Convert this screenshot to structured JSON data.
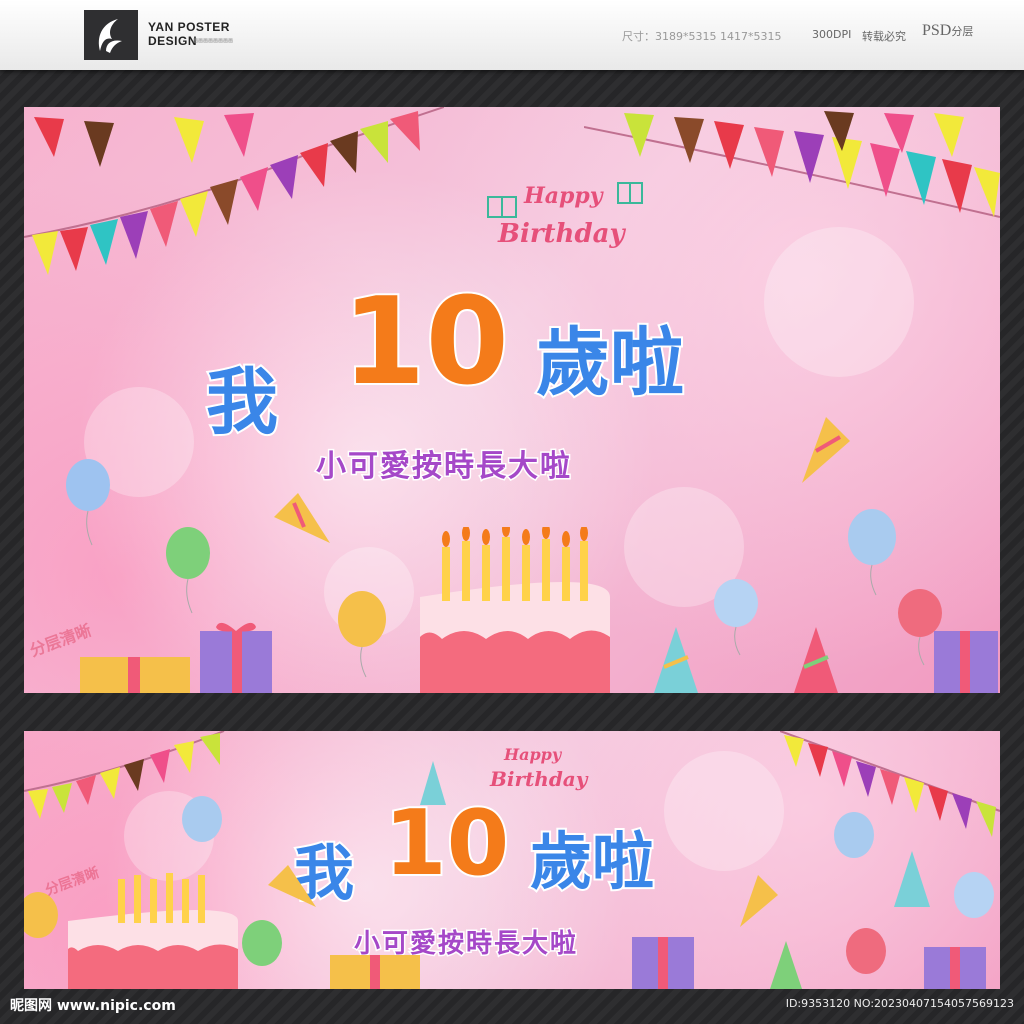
{
  "header": {
    "brand_line1": "YAN POSTER",
    "brand_line2": "DESIGN",
    "brand_sub": "画画画画画画画画",
    "size_text": "尺寸：3189*5315  1417*5315",
    "dpi_text": "300DPI",
    "copyright_text": "转载必究",
    "psd_text": "PSD",
    "psd_suffix": "分层"
  },
  "poster_large": {
    "greeting_line1": "Happy",
    "greeting_line2": "Birthday",
    "title_part1": "我",
    "title_number": "10",
    "title_part2": "歲啦",
    "subtitle": "小可愛按時長大啦",
    "watermark": "分层清晰"
  },
  "poster_wide": {
    "greeting_line1": "Happy",
    "greeting_line2": "Birthday",
    "title_part1": "我",
    "title_number": "10",
    "title_part2": "歲啦",
    "subtitle": "小可愛按時長大啦",
    "watermark": "分层清晰"
  },
  "footer": {
    "site": "昵图网 www.nipic.com",
    "id_text": "ID:9353120 NO:20230407154057569123"
  },
  "colors": {
    "pink_bg": "#f4c6dd",
    "title_blue": "#3a86e8",
    "title_orange": "#f47b1a",
    "subtitle_purple": "#a548c8"
  },
  "icons": [
    "yan-logo-icon",
    "balloon-icon",
    "cake-icon",
    "gift-icon",
    "party-hat-icon",
    "party-popper-icon",
    "bunting-flag-icon"
  ]
}
